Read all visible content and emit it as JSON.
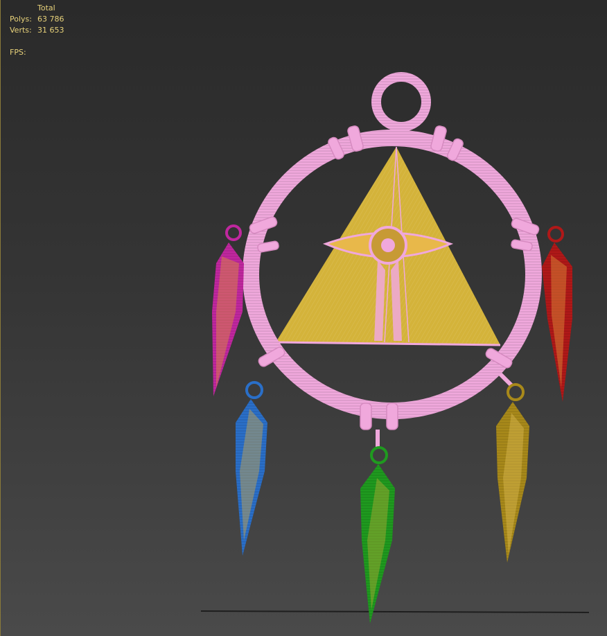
{
  "stats": {
    "header": "Total",
    "polys_label": "Polys:",
    "polys_value": "63 786",
    "verts_label": "Verts:",
    "verts_value": "31 653",
    "fps_label": "FPS:"
  },
  "colors": {
    "frame": "#f0a8dc",
    "triangle": "#d4b33a",
    "magenta": "#c0279f",
    "red": "#b01818",
    "blue": "#2a6fc8",
    "green": "#1f9a1f",
    "gold": "#a8891a"
  }
}
